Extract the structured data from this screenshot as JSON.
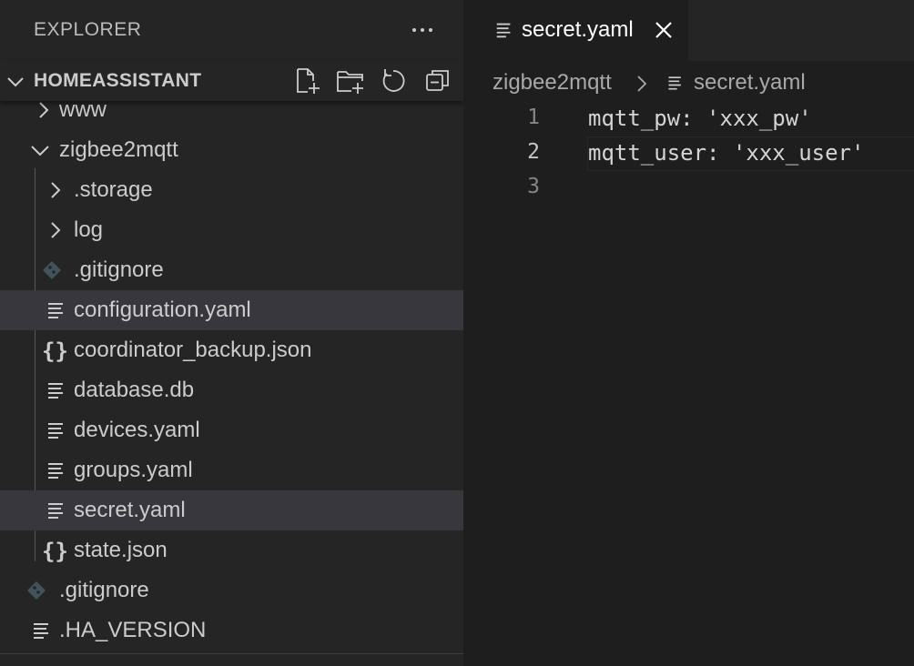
{
  "sidebar": {
    "title": "EXPLORER",
    "more_icon": "ellipsis-icon",
    "section": {
      "title": "HOMEASSISTANT",
      "actions": [
        "new-file-icon",
        "new-folder-icon",
        "refresh-icon",
        "collapse-all-icon"
      ]
    },
    "items": [
      {
        "label": "www",
        "type": "folder",
        "expanded": false
      },
      {
        "label": "zigbee2mqtt",
        "type": "folder",
        "expanded": true
      },
      {
        "label": ".storage",
        "type": "folder",
        "expanded": false
      },
      {
        "label": "log",
        "type": "folder",
        "expanded": false
      },
      {
        "label": ".gitignore",
        "type": "git"
      },
      {
        "label": "configuration.yaml",
        "type": "text",
        "selected": true
      },
      {
        "label": "coordinator_backup.json",
        "type": "json"
      },
      {
        "label": "database.db",
        "type": "text"
      },
      {
        "label": "devices.yaml",
        "type": "text"
      },
      {
        "label": "groups.yaml",
        "type": "text"
      },
      {
        "label": "secret.yaml",
        "type": "text",
        "selected": true
      },
      {
        "label": "state.json",
        "type": "json"
      },
      {
        "label": ".gitignore",
        "type": "git"
      },
      {
        "label": ".HA_VERSION",
        "type": "text"
      }
    ],
    "json_icon_text": "{}"
  },
  "editor": {
    "tab": {
      "label": "secret.yaml",
      "close_icon": "close-icon"
    },
    "breadcrumb": {
      "folder": "zigbee2mqtt",
      "file": "secret.yaml"
    },
    "lines": [
      {
        "number": "1",
        "text": "mqtt_pw: 'xxx_pw'"
      },
      {
        "number": "2",
        "text": "mqtt_user: 'xxx_user'",
        "current": true
      },
      {
        "number": "3",
        "text": ""
      }
    ]
  },
  "colors": {
    "sidebar_bg": "#252526",
    "editor_bg": "#1e1e1e",
    "selection_bg": "#37373d",
    "json_icon": "#cbcb41",
    "git_icon": "#41535b"
  }
}
